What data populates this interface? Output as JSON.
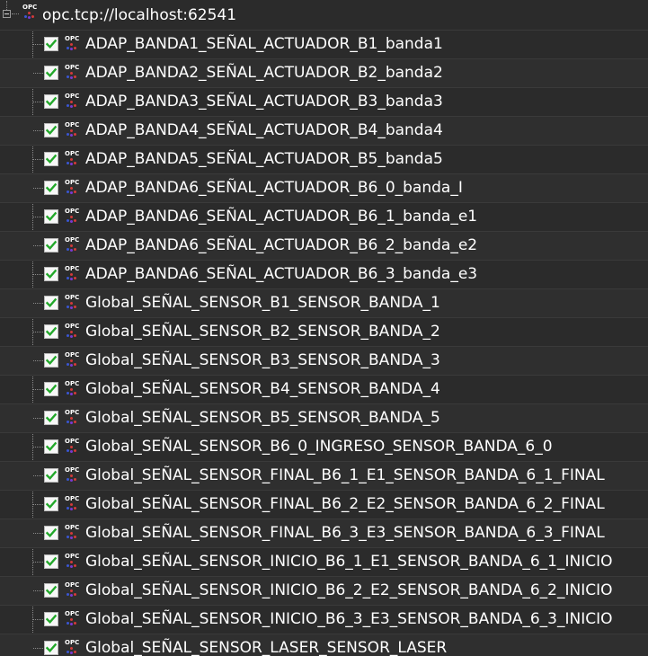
{
  "root": {
    "label": "opc.tcp://localhost:62541",
    "icon": "opc-server-icon",
    "expanded": true
  },
  "items": [
    {
      "label": "ADAP_BANDA1_SEÑAL_ACTUADOR_B1_banda1",
      "checked": true
    },
    {
      "label": "ADAP_BANDA2_SEÑAL_ACTUADOR_B2_banda2",
      "checked": true
    },
    {
      "label": "ADAP_BANDA3_SEÑAL_ACTUADOR_B3_banda3",
      "checked": true
    },
    {
      "label": "ADAP_BANDA4_SEÑAL_ACTUADOR_B4_banda4",
      "checked": true
    },
    {
      "label": "ADAP_BANDA5_SEÑAL_ACTUADOR_B5_banda5",
      "checked": true
    },
    {
      "label": "ADAP_BANDA6_SEÑAL_ACTUADOR_B6_0_banda_I",
      "checked": true
    },
    {
      "label": "ADAP_BANDA6_SEÑAL_ACTUADOR_B6_1_banda_e1",
      "checked": true
    },
    {
      "label": "ADAP_BANDA6_SEÑAL_ACTUADOR_B6_2_banda_e2",
      "checked": true
    },
    {
      "label": "ADAP_BANDA6_SEÑAL_ACTUADOR_B6_3_banda_e3",
      "checked": true
    },
    {
      "label": "Global_SEÑAL_SENSOR_B1_SENSOR_BANDA_1",
      "checked": true
    },
    {
      "label": "Global_SEÑAL_SENSOR_B2_SENSOR_BANDA_2",
      "checked": true
    },
    {
      "label": "Global_SEÑAL_SENSOR_B3_SENSOR_BANDA_3",
      "checked": true
    },
    {
      "label": "Global_SEÑAL_SENSOR_B4_SENSOR_BANDA_4",
      "checked": true
    },
    {
      "label": "Global_SEÑAL_SENSOR_B5_SENSOR_BANDA_5",
      "checked": true
    },
    {
      "label": "Global_SEÑAL_SENSOR_B6_0_INGRESO_SENSOR_BANDA_6_0",
      "checked": true
    },
    {
      "label": "Global_SEÑAL_SENSOR_FINAL_B6_1_E1_SENSOR_BANDA_6_1_FINAL",
      "checked": true
    },
    {
      "label": "Global_SEÑAL_SENSOR_FINAL_B6_2_E2_SENSOR_BANDA_6_2_FINAL",
      "checked": true
    },
    {
      "label": "Global_SEÑAL_SENSOR_FINAL_B6_3_E3_SENSOR_BANDA_6_3_FINAL",
      "checked": true
    },
    {
      "label": "Global_SEÑAL_SENSOR_INICIO_B6_1_E1_SENSOR_BANDA_6_1_INICIO",
      "checked": true
    },
    {
      "label": "Global_SEÑAL_SENSOR_INICIO_B6_2_E2_SENSOR_BANDA_6_2_INICIO",
      "checked": true
    },
    {
      "label": "Global_SEÑAL_SENSOR_INICIO_B6_3_E3_SENSOR_BANDA_6_3_INICIO",
      "checked": true
    },
    {
      "label": "Global_SEÑAL_SENSOR_LASER_SENSOR_LASER",
      "checked": true
    }
  ],
  "colors": {
    "background": "#2b2b2b",
    "text": "#ffffff",
    "check": "#22a82a"
  },
  "item_icon": "opc-tag-icon",
  "checkbox_icon": "checkmark-icon"
}
